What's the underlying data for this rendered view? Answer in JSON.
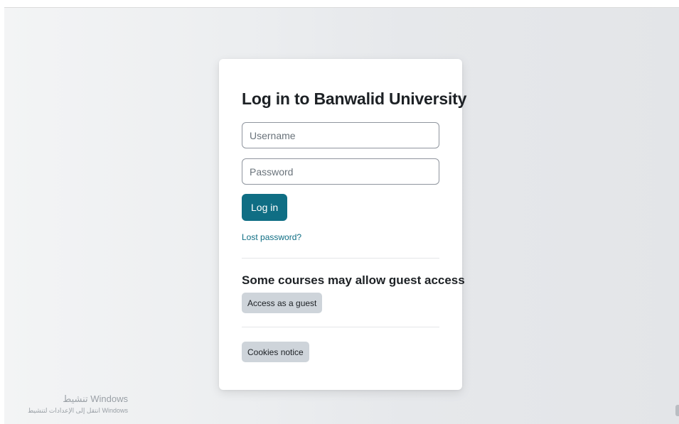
{
  "login": {
    "title": "Log in to Banwalid University",
    "username_placeholder": "Username",
    "password_placeholder": "Password",
    "login_button": "Log in",
    "lost_password": "Lost password?"
  },
  "guest": {
    "heading": "Some courses may allow guest access",
    "button": "Access as a guest"
  },
  "footer": {
    "cookies_button": "Cookies notice"
  },
  "watermark": {
    "line1": "تنشيط Windows",
    "line2": "انتقل إلى الإعدادات لتنشيط Windows"
  },
  "colors": {
    "primary": "#0f6e84",
    "secondary": "#ced4da",
    "text": "#1d2125"
  }
}
